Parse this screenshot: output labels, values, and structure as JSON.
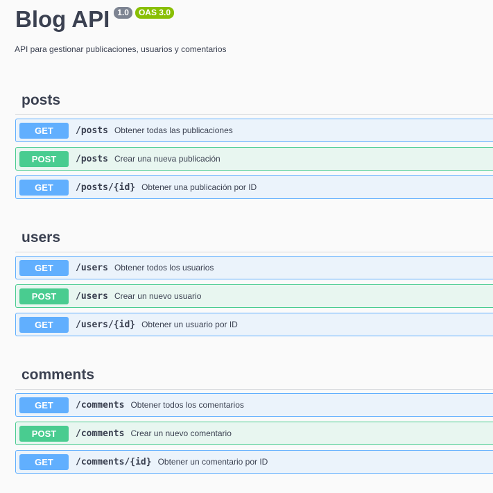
{
  "info": {
    "title": "Blog API",
    "version": "1.0",
    "oas": "OAS 3.0",
    "description": "API para gestionar publicaciones, usuarios y comentarios"
  },
  "colors": {
    "get": "#61affe",
    "post": "#49cc90",
    "get_bg": "#ebf3fb",
    "post_bg": "#e8f6f0"
  },
  "sections": [
    {
      "name": "posts",
      "operations": [
        {
          "method": "GET",
          "path": "/posts",
          "summary": "Obtener todas las publicaciones"
        },
        {
          "method": "POST",
          "path": "/posts",
          "summary": "Crear una nueva publicación"
        },
        {
          "method": "GET",
          "path": "/posts/{id}",
          "summary": "Obtener una publicación por ID"
        }
      ]
    },
    {
      "name": "users",
      "operations": [
        {
          "method": "GET",
          "path": "/users",
          "summary": "Obtener todos los usuarios"
        },
        {
          "method": "POST",
          "path": "/users",
          "summary": "Crear un nuevo usuario"
        },
        {
          "method": "GET",
          "path": "/users/{id}",
          "summary": "Obtener un usuario por ID"
        }
      ]
    },
    {
      "name": "comments",
      "operations": [
        {
          "method": "GET",
          "path": "/comments",
          "summary": "Obtener todos los comentarios"
        },
        {
          "method": "POST",
          "path": "/comments",
          "summary": "Crear un nuevo comentario"
        },
        {
          "method": "GET",
          "path": "/comments/{id}",
          "summary": "Obtener un comentario por ID"
        }
      ]
    }
  ]
}
